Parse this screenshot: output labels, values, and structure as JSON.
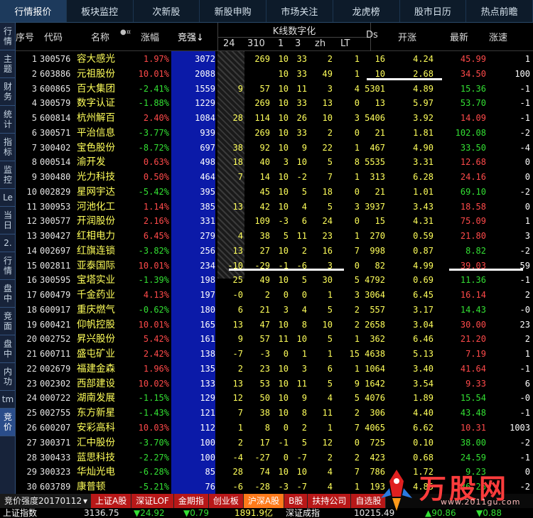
{
  "top_tabs": [
    {
      "label": "行情报价",
      "active": true
    },
    {
      "label": "板块监控",
      "active": false
    },
    {
      "label": "次新股",
      "active": false
    },
    {
      "label": "新股申购",
      "active": false
    },
    {
      "label": "市场关注",
      "active": false
    },
    {
      "label": "龙虎榜",
      "active": false
    },
    {
      "label": "股市日历",
      "active": false
    },
    {
      "label": "热点前瞻",
      "active": false
    }
  ],
  "left_tabs": [
    {
      "label": "行情",
      "active": false
    },
    {
      "label": "主题",
      "active": false
    },
    {
      "label": "财务",
      "active": false
    },
    {
      "label": "统计",
      "active": false
    },
    {
      "label": "指标",
      "active": false
    },
    {
      "label": "监控",
      "active": false
    },
    {
      "label": "Le",
      "active": false
    },
    {
      "label": "当日",
      "active": false
    },
    {
      "label": "2.",
      "active": false
    },
    {
      "label": "行情",
      "active": false
    },
    {
      "label": "盘中",
      "active": false
    },
    {
      "label": "竞面",
      "active": false
    },
    {
      "label": "盘中",
      "active": false
    },
    {
      "label": "内功",
      "active": false
    },
    {
      "label": "tm",
      "active": false
    },
    {
      "label": "竞价",
      "active": true
    }
  ],
  "columns": {
    "idx": "序号",
    "code": "代码",
    "name": "名称",
    "name_marker": "●¤",
    "chg": "涨幅",
    "strength": "竞强↓",
    "kgroup": "K线数字化",
    "k24": "24",
    "k310": "310",
    "k1": "1",
    "k3": "3",
    "kzh": "zh",
    "klt": "LT",
    "ds": "Ds",
    "kz": "开涨",
    "new": "最新",
    "spd": "涨速"
  },
  "rows": [
    {
      "idx": "1",
      "code": "300576",
      "name": "容大感光",
      "chg": "1.97%",
      "str": "3072",
      "k24": "",
      "k310": "269",
      "k1": "10",
      "k3": "33",
      "kzh": "2",
      "klt": "1",
      "ds": "16",
      "kz": "4.24",
      "new": "45.99",
      "spd": "1"
    },
    {
      "idx": "2",
      "code": "603886",
      "name": "元祖股份",
      "chg": "10.01%",
      "str": "2088",
      "k24": "",
      "k310": "",
      "k1": "10",
      "k3": "33",
      "kzh": "49",
      "klt": "1",
      "ds": "10",
      "kz": "2.68",
      "new": "34.50",
      "spd": "100"
    },
    {
      "idx": "3",
      "code": "600865",
      "name": "百大集团",
      "chg": "-2.41%",
      "str": "1559",
      "k24": "9",
      "k310": "57",
      "k1": "10",
      "k3": "11",
      "kzh": "3",
      "klt": "4",
      "ds": "5301",
      "kz": "4.89",
      "new": "15.36",
      "spd": "-1"
    },
    {
      "idx": "4",
      "code": "300579",
      "name": "数字认证",
      "chg": "-1.88%",
      "str": "1229",
      "k24": "",
      "k310": "269",
      "k1": "10",
      "k3": "33",
      "kzh": "13",
      "klt": "0",
      "ds": "13",
      "kz": "5.97",
      "new": "53.70",
      "spd": "-1"
    },
    {
      "idx": "5",
      "code": "600814",
      "name": "杭州解百",
      "chg": "2.40%",
      "str": "1084",
      "k24": "28",
      "k310": "114",
      "k1": "10",
      "k3": "26",
      "kzh": "10",
      "klt": "3",
      "ds": "5406",
      "kz": "3.92",
      "new": "14.09",
      "spd": "-1"
    },
    {
      "idx": "6",
      "code": "300571",
      "name": "平治信息",
      "chg": "-3.77%",
      "str": "939",
      "k24": "",
      "k310": "269",
      "k1": "10",
      "k3": "33",
      "kzh": "2",
      "klt": "0",
      "ds": "21",
      "kz": "1.81",
      "new": "102.08",
      "spd": "-2"
    },
    {
      "idx": "7",
      "code": "300402",
      "name": "宝色股份",
      "chg": "-8.72%",
      "str": "697",
      "k24": "38",
      "k310": "92",
      "k1": "10",
      "k3": "9",
      "kzh": "22",
      "klt": "1",
      "ds": "467",
      "kz": "4.90",
      "new": "33.50",
      "spd": "-4"
    },
    {
      "idx": "8",
      "code": "000514",
      "name": "渝开发",
      "chg": "0.63%",
      "str": "498",
      "k24": "18",
      "k310": "40",
      "k1": "3",
      "k3": "10",
      "kzh": "5",
      "klt": "8",
      "ds": "5535",
      "kz": "3.31",
      "new": "12.68",
      "spd": "0"
    },
    {
      "idx": "9",
      "code": "300480",
      "name": "光力科技",
      "chg": "0.50%",
      "str": "464",
      "k24": "7",
      "k310": "14",
      "k1": "10",
      "k3": "-2",
      "kzh": "7",
      "klt": "1",
      "ds": "313",
      "kz": "6.28",
      "new": "24.16",
      "spd": "0"
    },
    {
      "idx": "10",
      "code": "002829",
      "name": "星网宇达",
      "chg": "-5.42%",
      "str": "395",
      "k24": "",
      "k310": "45",
      "k1": "10",
      "k3": "5",
      "kzh": "18",
      "klt": "0",
      "ds": "21",
      "kz": "1.01",
      "new": "69.10",
      "spd": "-2"
    },
    {
      "idx": "11",
      "code": "300953",
      "name": "河池化工",
      "chg": "1.14%",
      "str": "385",
      "k24": "13",
      "k310": "42",
      "k1": "10",
      "k3": "4",
      "kzh": "5",
      "klt": "3",
      "ds": "3937",
      "kz": "3.43",
      "new": "18.58",
      "spd": "0"
    },
    {
      "idx": "12",
      "code": "300577",
      "name": "开润股份",
      "chg": "2.16%",
      "str": "331",
      "k24": "",
      "k310": "109",
      "k1": "-3",
      "k3": "6",
      "kzh": "24",
      "klt": "0",
      "ds": "15",
      "kz": "4.31",
      "new": "75.09",
      "spd": "1"
    },
    {
      "idx": "13",
      "code": "300427",
      "name": "红相电力",
      "chg": "6.45%",
      "str": "279",
      "k24": "4",
      "k310": "38",
      "k1": "5",
      "k3": "11",
      "kzh": "23",
      "klt": "1",
      "ds": "270",
      "kz": "0.59",
      "new": "21.80",
      "spd": "3"
    },
    {
      "idx": "14",
      "code": "002697",
      "name": "红旗连锁",
      "chg": "-3.82%",
      "str": "256",
      "k24": "13",
      "k310": "27",
      "k1": "10",
      "k3": "2",
      "kzh": "16",
      "klt": "7",
      "ds": "998",
      "kz": "0.87",
      "new": "8.82",
      "spd": "-2"
    },
    {
      "idx": "15",
      "code": "002811",
      "name": "亚泰国际",
      "chg": "10.01%",
      "str": "234",
      "k24": "-10",
      "k310": "-29",
      "k1": "-1",
      "k3": "-6",
      "kzh": "3",
      "klt": "0",
      "ds": "82",
      "kz": "4.99",
      "new": "39.03",
      "spd": "59"
    },
    {
      "idx": "16",
      "code": "300595",
      "name": "宝塔实业",
      "chg": "-1.39%",
      "str": "198",
      "k24": "25",
      "k310": "49",
      "k1": "10",
      "k3": "5",
      "kzh": "30",
      "klt": "5",
      "ds": "4792",
      "kz": "0.69",
      "new": "11.36",
      "spd": "-1"
    },
    {
      "idx": "17",
      "code": "600479",
      "name": "千金药业",
      "chg": "4.13%",
      "str": "197",
      "k24": "-0",
      "k310": "2",
      "k1": "0",
      "k3": "0",
      "kzh": "1",
      "klt": "3",
      "ds": "3064",
      "kz": "6.45",
      "new": "16.14",
      "spd": "2"
    },
    {
      "idx": "18",
      "code": "600917",
      "name": "重庆燃气",
      "chg": "-0.62%",
      "str": "180",
      "k24": "6",
      "k310": "21",
      "k1": "3",
      "k3": "4",
      "kzh": "5",
      "klt": "2",
      "ds": "557",
      "kz": "3.17",
      "new": "14.43",
      "spd": "-0"
    },
    {
      "idx": "19",
      "code": "600421",
      "name": "仰帆控股",
      "chg": "10.01%",
      "str": "165",
      "k24": "13",
      "k310": "47",
      "k1": "10",
      "k3": "8",
      "kzh": "10",
      "klt": "2",
      "ds": "2658",
      "kz": "3.04",
      "new": "30.00",
      "spd": "23"
    },
    {
      "idx": "20",
      "code": "002752",
      "name": "昇兴股份",
      "chg": "5.42%",
      "str": "161",
      "k24": "9",
      "k310": "57",
      "k1": "11",
      "k3": "10",
      "kzh": "5",
      "klt": "1",
      "ds": "362",
      "kz": "6.46",
      "new": "21.20",
      "spd": "2"
    },
    {
      "idx": "21",
      "code": "600711",
      "name": "盛屯矿业",
      "chg": "2.42%",
      "str": "138",
      "k24": "-7",
      "k310": "-3",
      "k1": "0",
      "k3": "1",
      "kzh": "1",
      "klt": "15",
      "ds": "4638",
      "kz": "5.13",
      "new": "7.19",
      "spd": "1"
    },
    {
      "idx": "22",
      "code": "002679",
      "name": "福建金森",
      "chg": "1.96%",
      "str": "135",
      "k24": "2",
      "k310": "23",
      "k1": "10",
      "k3": "3",
      "kzh": "6",
      "klt": "1",
      "ds": "1064",
      "kz": "3.40",
      "new": "41.64",
      "spd": "-1"
    },
    {
      "idx": "23",
      "code": "002302",
      "name": "西部建设",
      "chg": "10.02%",
      "str": "133",
      "k24": "13",
      "k310": "53",
      "k1": "10",
      "k3": "11",
      "kzh": "5",
      "klt": "9",
      "ds": "1642",
      "kz": "3.54",
      "new": "9.33",
      "spd": "6"
    },
    {
      "idx": "24",
      "code": "000722",
      "name": "湖南发展",
      "chg": "-1.15%",
      "str": "129",
      "k24": "12",
      "k310": "50",
      "k1": "10",
      "k3": "9",
      "kzh": "4",
      "klt": "5",
      "ds": "4076",
      "kz": "1.89",
      "new": "15.54",
      "spd": "-0"
    },
    {
      "idx": "25",
      "code": "002755",
      "name": "东方新星",
      "chg": "-1.43%",
      "str": "121",
      "k24": "7",
      "k310": "38",
      "k1": "10",
      "k3": "8",
      "kzh": "11",
      "klt": "2",
      "ds": "306",
      "kz": "4.40",
      "new": "43.48",
      "spd": "-1"
    },
    {
      "idx": "26",
      "code": "600207",
      "name": "安彩高科",
      "chg": "10.03%",
      "str": "112",
      "k24": "1",
      "k310": "8",
      "k1": "0",
      "k3": "2",
      "kzh": "1",
      "klt": "7",
      "ds": "4065",
      "kz": "6.62",
      "new": "10.31",
      "spd": "1003"
    },
    {
      "idx": "27",
      "code": "300371",
      "name": "汇中股份",
      "chg": "-3.70%",
      "str": "100",
      "k24": "2",
      "k310": "17",
      "k1": "-1",
      "k3": "5",
      "kzh": "12",
      "klt": "0",
      "ds": "725",
      "kz": "0.10",
      "new": "38.00",
      "spd": "-2"
    },
    {
      "idx": "28",
      "code": "300433",
      "name": "蓝思科技",
      "chg": "-2.27%",
      "str": "100",
      "k24": "-4",
      "k310": "-27",
      "k1": "0",
      "k3": "-7",
      "kzh": "2",
      "klt": "2",
      "ds": "423",
      "kz": "0.68",
      "new": "24.59",
      "spd": "-1"
    },
    {
      "idx": "29",
      "code": "300323",
      "name": "华灿光电",
      "chg": "-6.28%",
      "str": "85",
      "k24": "28",
      "k310": "74",
      "k1": "10",
      "k3": "10",
      "kzh": "4",
      "klt": "7",
      "ds": "786",
      "kz": "1.72",
      "new": "9.23",
      "spd": "0"
    },
    {
      "idx": "30",
      "code": "603789",
      "name": "康普顿",
      "chg": "-5.21%",
      "str": "76",
      "k24": "-6",
      "k310": "-28",
      "k1": "-3",
      "k3": "-7",
      "kzh": "4",
      "klt": "1",
      "ds": "193",
      "kz": "4.85",
      "new": "36.26",
      "spd": "-2"
    }
  ],
  "bottom_tabs": {
    "selector": "竞价强度20170112",
    "items": [
      "上证A股",
      "深证LOF",
      "金期指",
      "创业板",
      "沪深A股",
      "B股",
      "扶持公司",
      "自选股"
    ]
  },
  "status": {
    "index_name": "上证指数",
    "index_value": "3136.75",
    "index_change": "▼24.92",
    "index_pct": "▼0.79",
    "amount": "1891.9亿",
    "sz_name": "深证成指",
    "sz_value": "10215.49",
    "sz_change": "▲90.86",
    "sz_pct": "▼0.88"
  },
  "watermark": {
    "text": "万股网",
    "url": "www.2011gu.com"
  },
  "colors": {
    "up": "#ff4a4a",
    "down": "#33e033",
    "strength_bg": "#0b1aa8",
    "neutral": "#ffff5a"
  }
}
